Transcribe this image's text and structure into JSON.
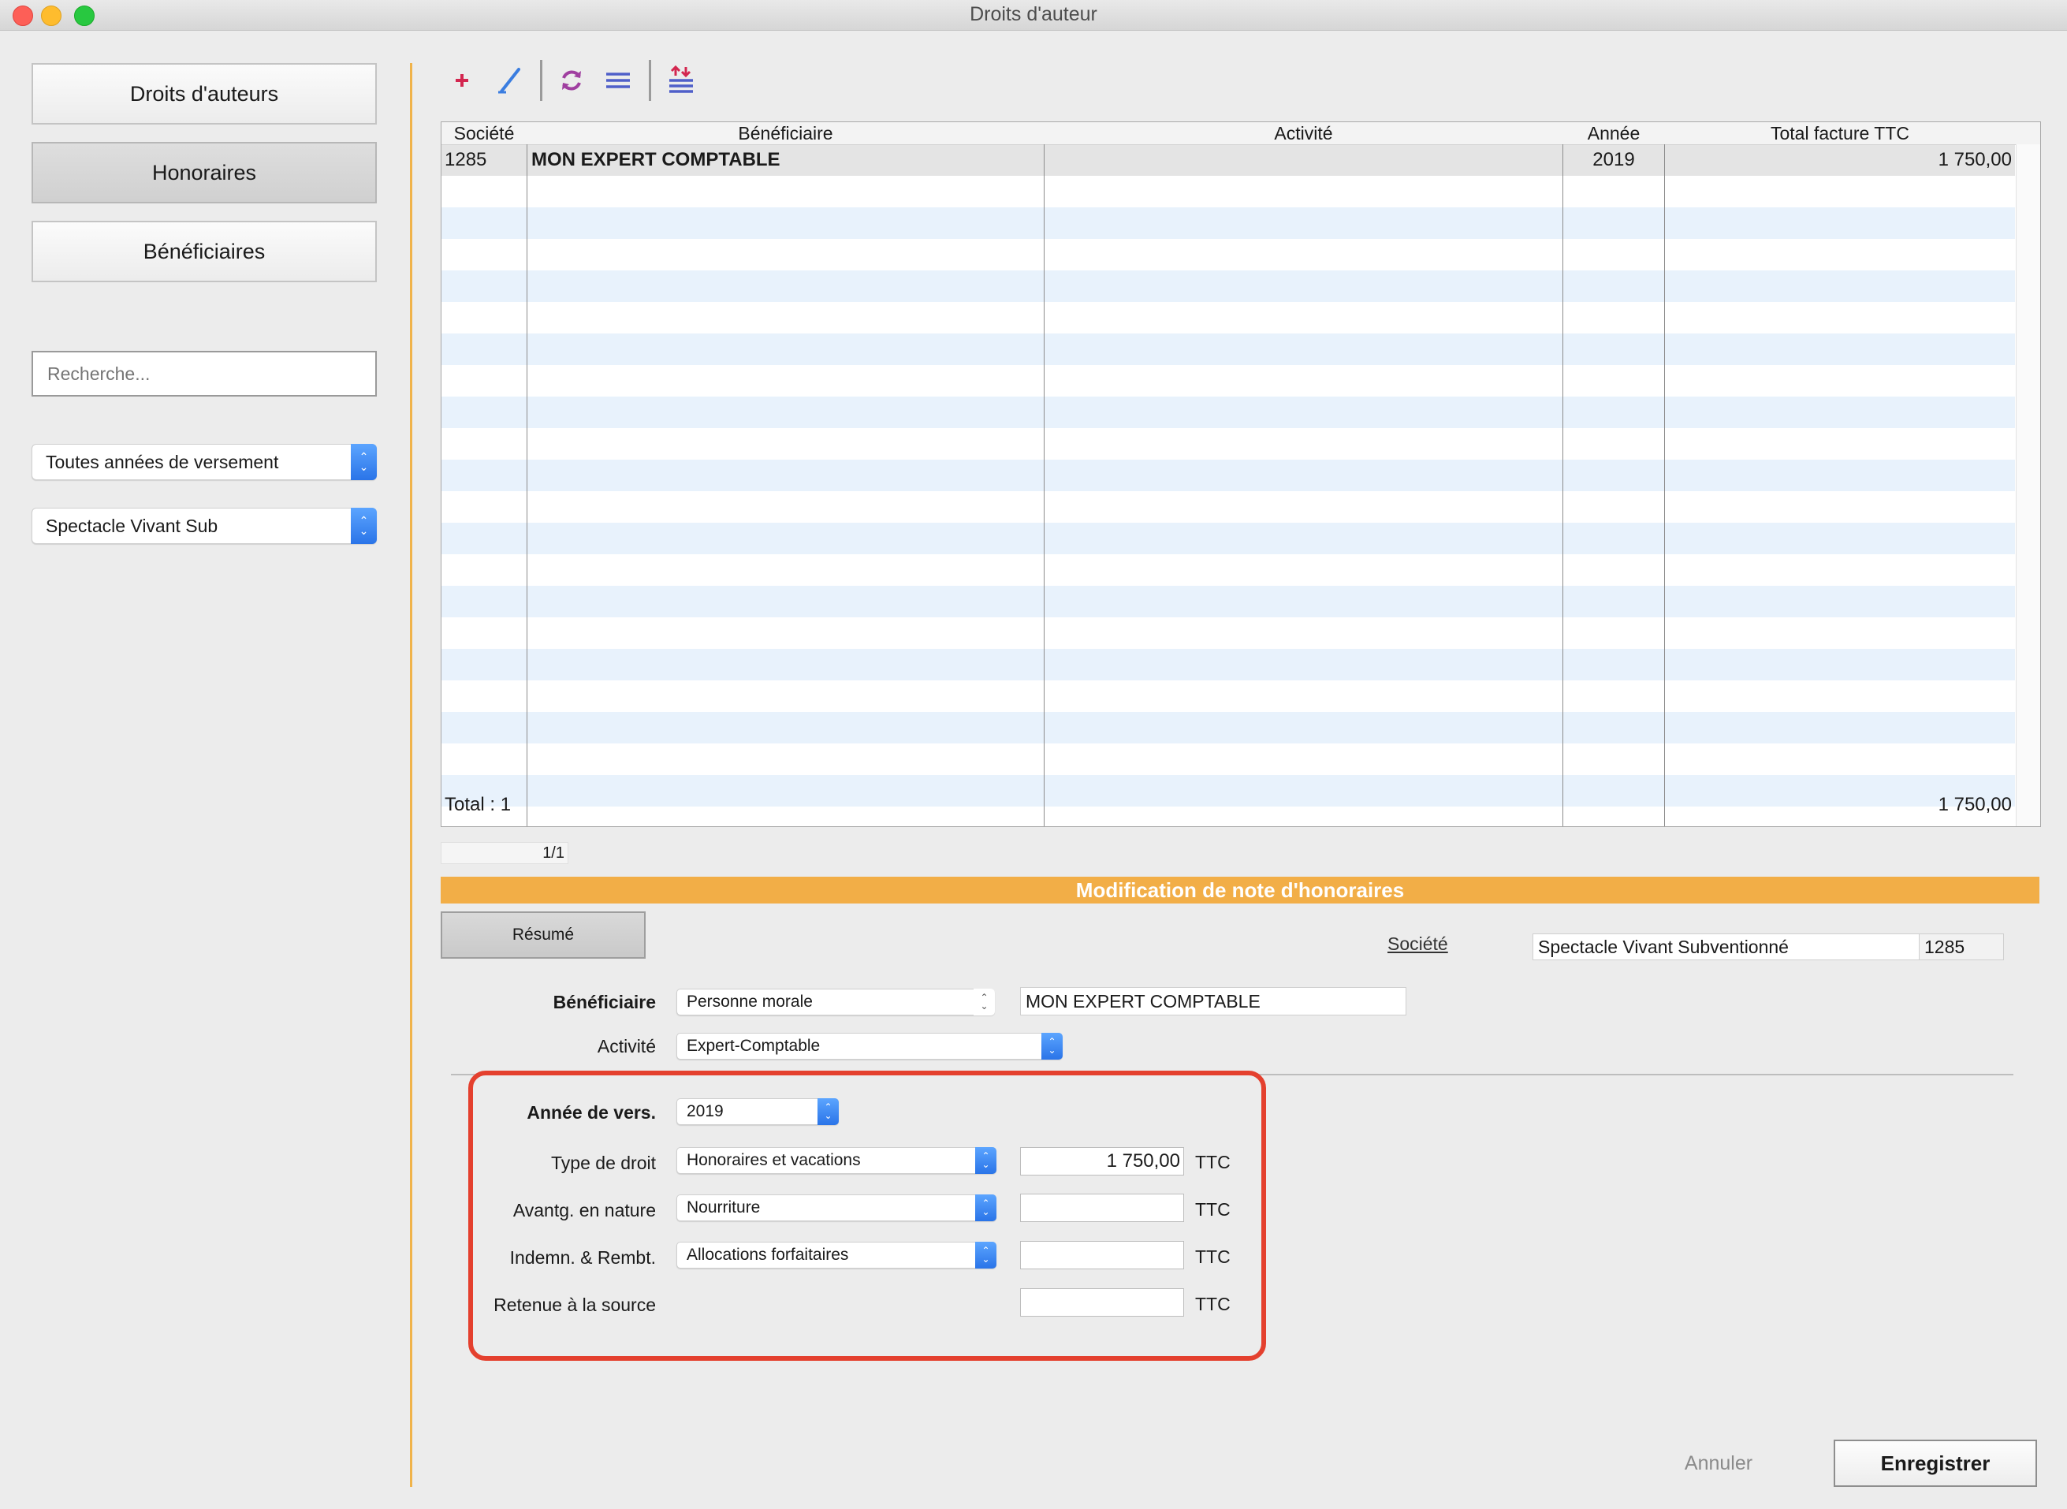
{
  "window": {
    "title": "Droits d'auteur"
  },
  "sidebar": {
    "nav": [
      {
        "label": "Droits d'auteurs",
        "active": false
      },
      {
        "label": "Honoraires",
        "active": true
      },
      {
        "label": "Bénéficiaires",
        "active": false
      }
    ],
    "search_placeholder": "Recherche...",
    "year_filter": "Toutes années de versement",
    "company_filter": "Spectacle Vivant Sub"
  },
  "toolbar": {
    "icons": [
      "add-icon",
      "edit-pen-icon",
      "refresh-icon",
      "list-icon",
      "sort-icon"
    ]
  },
  "table": {
    "columns": [
      "Société",
      "Bénéficiaire",
      "Activité",
      "Année",
      "Total facture TTC"
    ],
    "rows": [
      {
        "societe": "1285",
        "beneficiaire": "MON EXPERT COMPTABLE",
        "activite": "",
        "annee": "2019",
        "total": "1 750,00"
      }
    ],
    "footer": {
      "count_label": "Total : 1",
      "total": "1 750,00"
    },
    "pager": "1/1"
  },
  "form": {
    "banner": "Modification de note d'honoraires",
    "tab_resume": "Résumé",
    "societe_label": "Société",
    "societe_name": "Spectacle Vivant Subventionné",
    "societe_code": "1285",
    "beneficiaire_label": "Bénéficiaire",
    "beneficiaire_type": "Personne morale",
    "beneficiaire_name": "MON EXPERT COMPTABLE",
    "activite_label": "Activité",
    "activite_value": "Expert-Comptable",
    "annee_label": "Année de vers.",
    "annee_value": "2019",
    "type_droit_label": "Type de droit",
    "type_droit_value": "Honoraires et vacations",
    "type_droit_amount": "1 750,00",
    "avantages_label": "Avantg. en nature",
    "avantages_value": "Nourriture",
    "avantages_amount": "",
    "indemn_label": "Indemn. & Rembt.",
    "indemn_value": "Allocations forfaitaires",
    "indemn_amount": "",
    "retenue_label": "Retenue à la source",
    "retenue_amount": "",
    "unit": "TTC"
  },
  "buttons": {
    "cancel": "Annuler",
    "save": "Enregistrer"
  },
  "colors": {
    "accent": "#f2ae47",
    "highlight": "#e4402e",
    "stepper": "#2a74e8"
  }
}
